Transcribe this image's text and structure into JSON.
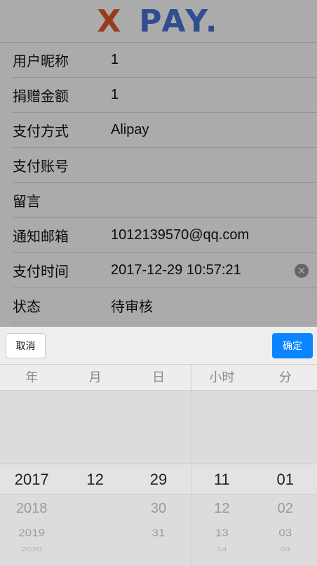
{
  "logo": {
    "left": "X",
    "right": "PAY."
  },
  "form": [
    {
      "label": "用户昵称",
      "value": "1"
    },
    {
      "label": "捐赠金额",
      "value": "1"
    },
    {
      "label": "支付方式",
      "value": "Alipay"
    },
    {
      "label": "支付账号",
      "value": ""
    },
    {
      "label": "留言",
      "value": ""
    },
    {
      "label": "通知邮箱",
      "value": "1012139570@qq.com"
    },
    {
      "label": "支付时间",
      "value": "2017-12-29 10:57:21"
    },
    {
      "label": "状态",
      "value": "待审核"
    }
  ],
  "picker": {
    "cancel_label": "取消",
    "confirm_label": "确定",
    "headers": [
      "年",
      "月",
      "日",
      "小时",
      "分"
    ],
    "columns": [
      {
        "selected": "2017",
        "next": [
          "2018",
          "2019",
          "2020"
        ]
      },
      {
        "selected": "12",
        "next": [
          "",
          "",
          ""
        ]
      },
      {
        "selected": "29",
        "next": [
          "30",
          "31",
          ""
        ]
      },
      {
        "selected": "11",
        "next": [
          "12",
          "13",
          "14"
        ]
      },
      {
        "selected": "01",
        "next": [
          "02",
          "03",
          "04"
        ]
      }
    ]
  },
  "colors": {
    "confirm": "#0a84ff",
    "logo_x": "#e05a2b",
    "logo_pay": "#4a74d8"
  },
  "icons": {
    "clear": "close-circle-icon"
  }
}
